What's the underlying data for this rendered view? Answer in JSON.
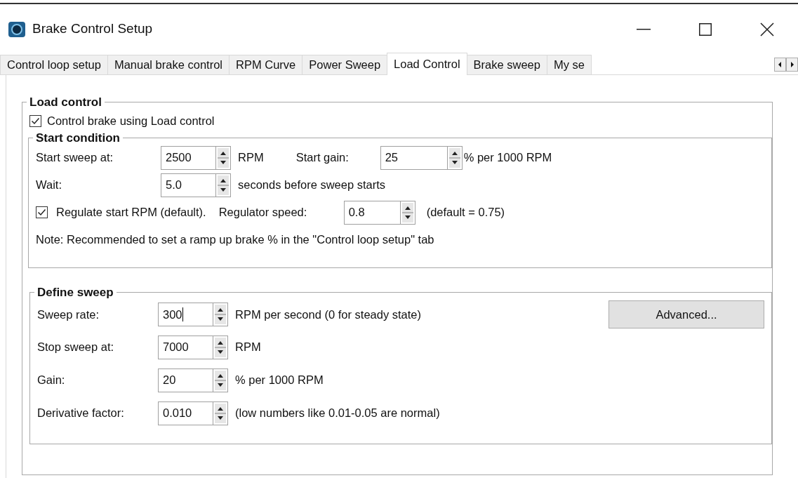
{
  "window": {
    "title": "Brake Control Setup"
  },
  "tabs": [
    {
      "label": "Control loop setup",
      "selected": false
    },
    {
      "label": "Manual brake control",
      "selected": false
    },
    {
      "label": "RPM Curve",
      "selected": false
    },
    {
      "label": "Power Sweep",
      "selected": false
    },
    {
      "label": "Load Control",
      "selected": true
    },
    {
      "label": "Brake sweep",
      "selected": false
    },
    {
      "label": "My se",
      "selected": false
    }
  ],
  "load_control": {
    "title": "Load control",
    "checkbox": {
      "label": "Control brake using Load control",
      "checked": true
    },
    "start_condition": {
      "title": "Start condition",
      "rows": [
        {
          "kind": "spins",
          "items": [
            {
              "label": "Start sweep at:",
              "value": "2500",
              "unit": "RPM",
              "focused": false
            },
            {
              "label": "Start gain:",
              "value": "25",
              "unit": "% per 1000 RPM",
              "focused": false
            }
          ]
        },
        {
          "kind": "spins",
          "items": [
            {
              "label": "Wait:",
              "value": "5.0",
              "unit": "seconds before sweep starts",
              "focused": false
            }
          ]
        },
        {
          "kind": "check",
          "label": "Regulate start RPM (default).",
          "checked": true,
          "spin_label": "Regulator speed:",
          "value": "0.8",
          "unit": "(default = 0.75)"
        },
        {
          "kind": "note",
          "text": "Note: Recommended to set a ramp up brake % in the \"Control loop setup\" tab"
        }
      ]
    },
    "define_sweep": {
      "title": "Define sweep",
      "button": "Advanced...",
      "rows": [
        {
          "kind": "spins",
          "items": [
            {
              "label": "Sweep rate:",
              "value": "300",
              "unit": "RPM per second (0 for steady state)",
              "focused": true
            }
          ]
        },
        {
          "kind": "spins",
          "items": [
            {
              "label": "Stop sweep at:",
              "value": "7000",
              "unit": "RPM",
              "focused": false
            }
          ]
        },
        {
          "kind": "spins",
          "items": [
            {
              "label": "Gain:",
              "value": "20",
              "unit": "% per 1000 RPM",
              "focused": false
            }
          ]
        },
        {
          "kind": "spins",
          "items": [
            {
              "label": "Derivative factor:",
              "value": "0.010",
              "unit": "(low numbers like 0.01-0.05 are normal)",
              "focused": false
            }
          ]
        }
      ]
    }
  }
}
